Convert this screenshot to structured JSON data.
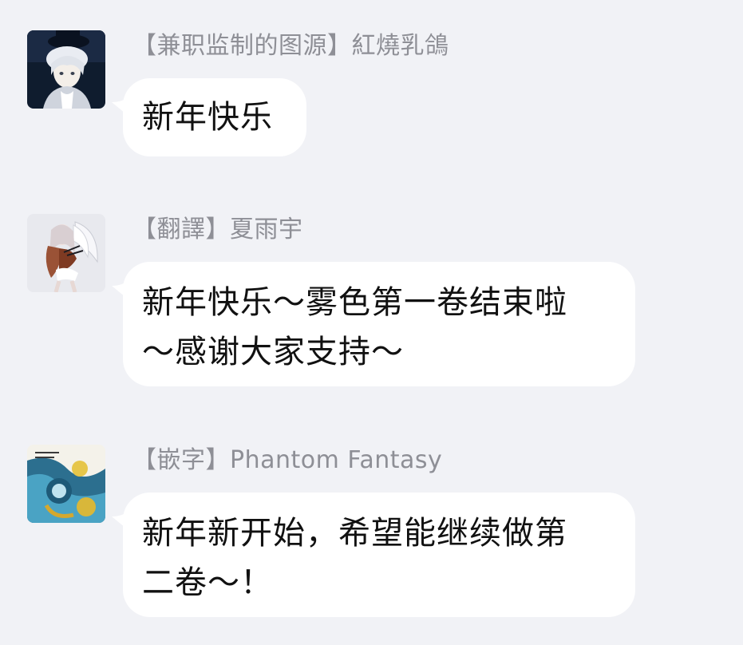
{
  "colors": {
    "background": "#f1f2f6",
    "bubble": "#ffffff",
    "sender_name": "#8e8f96",
    "message_text": "#111111"
  },
  "messages": [
    {
      "sender": "【兼职监制的图源】紅燒乳鴿",
      "avatar_icon": "avatar-boy-with-top-hat-icon",
      "lines": [
        "新年快乐"
      ]
    },
    {
      "sender": "【翻譯】夏雨宇",
      "avatar_icon": "avatar-angel-girl-icon",
      "lines": [
        "新年快乐～雾色第一卷结束啦",
        "～感谢大家支持～"
      ]
    },
    {
      "sender": "【嵌字】Phantom Fantasy",
      "avatar_icon": "avatar-blue-swirl-art-icon",
      "lines": [
        "新年新开始，希望能继续做第",
        "二卷～！"
      ]
    }
  ]
}
